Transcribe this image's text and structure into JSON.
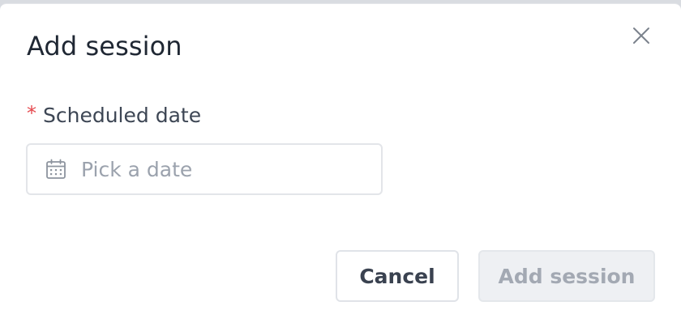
{
  "dialog": {
    "title": "Add session",
    "close_icon": "close-icon"
  },
  "form": {
    "date_field": {
      "required_marker": "*",
      "label": "Scheduled date",
      "placeholder": "Pick a date",
      "value": "",
      "icon": "calendar-icon"
    }
  },
  "actions": {
    "cancel_label": "Cancel",
    "submit_label": "Add session",
    "submit_disabled": true
  },
  "colors": {
    "required": "#e5484d",
    "title_text": "#1f2733",
    "placeholder_text": "#9ba2ad",
    "disabled_button_bg": "#eef0f3"
  }
}
